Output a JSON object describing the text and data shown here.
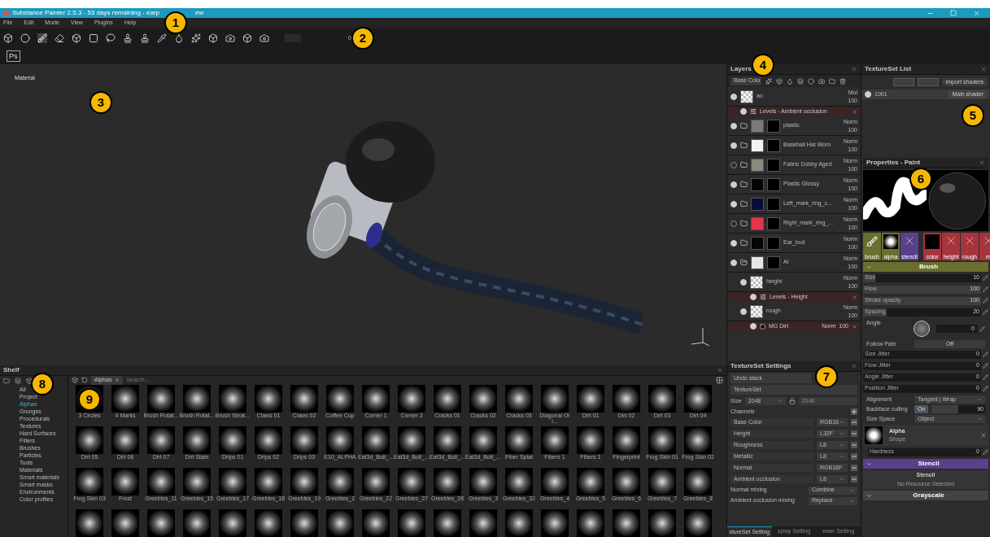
{
  "window": {
    "title": "Substance Painter 2.5.3 - 53 days remaining - earp",
    "title_tail": "ew"
  },
  "menu": [
    "File",
    "Edit",
    "Mode",
    "View",
    "Plugins",
    "Help"
  ],
  "toolbar": {
    "opacity_value": "0",
    "ps_label": "Ps"
  },
  "viewport": {
    "label": "Material"
  },
  "layers": {
    "title": "Layers",
    "channel": "Base Colo",
    "items": [
      {
        "kind": "fill",
        "name": "ao",
        "visible": true,
        "blend": "Mul",
        "opacity": "100",
        "effects": [
          {
            "kind": "levels",
            "name": "Levels - Ambient occlusion",
            "visible": true
          }
        ]
      },
      {
        "kind": "folder",
        "name": "plastic",
        "visible": true,
        "blend": "Norm",
        "opacity": "100",
        "color": "#7a7a7a"
      },
      {
        "kind": "folder",
        "name": "Baseball Hat Worn",
        "visible": true,
        "blend": "Norm",
        "opacity": "100",
        "color": "#f2f2f2"
      },
      {
        "kind": "folder",
        "name": "Fabric Dobby Aged",
        "visible": false,
        "blend": "Norm",
        "opacity": "100",
        "color": "#8c8a80"
      },
      {
        "kind": "folder",
        "name": "Plastic Glossy",
        "visible": true,
        "blend": "Norm",
        "opacity": "100",
        "color": "#050505"
      },
      {
        "kind": "folder",
        "name": "Left_mark_ring_c...",
        "visible": true,
        "blend": "Norm",
        "opacity": "100",
        "color": "#0b0b3a"
      },
      {
        "kind": "folder",
        "name": "Right_mark_ring_...",
        "visible": false,
        "blend": "Norm",
        "opacity": "100",
        "color": "#e8334a"
      },
      {
        "kind": "folder",
        "name": "Ear_bud",
        "visible": true,
        "blend": "Norm",
        "opacity": "100",
        "color": "#050505"
      },
      {
        "kind": "group",
        "name": "AI",
        "visible": true,
        "blend": "Norm",
        "opacity": "100",
        "color": "#e6e6e6",
        "children": [
          {
            "kind": "fill",
            "name": "height",
            "visible": true,
            "blend": "Norm",
            "opacity": "100",
            "effects": [
              {
                "kind": "levels",
                "name": "Levels - Height",
                "visible": true
              }
            ]
          },
          {
            "kind": "fill",
            "name": "rough",
            "visible": true,
            "blend": "Norm",
            "opacity": "100",
            "effects": [
              {
                "kind": "mask",
                "name": "MG Dirt",
                "visible": true,
                "blend": "Norm",
                "opacity": "100"
              }
            ]
          }
        ]
      }
    ]
  },
  "textureset_list": {
    "title": "TextureSet List",
    "import_button": "Import shaders",
    "rows": [
      {
        "name": "1001",
        "shader": "Main shader",
        "selected": true
      }
    ]
  },
  "properties": {
    "title": "Properties - Paint",
    "slots_left": [
      {
        "kind": "brush",
        "label": "brush"
      },
      {
        "kind": "alpha",
        "label": "alpha"
      },
      {
        "kind": "stencil",
        "label": "stencil"
      }
    ],
    "slots_right": [
      {
        "kind": "color",
        "label": "color"
      },
      {
        "kind": "empty",
        "label": "height"
      },
      {
        "kind": "empty",
        "label": "rough"
      },
      {
        "kind": "empty",
        "label": "m"
      }
    ],
    "brush_header": "Brush",
    "sliders": [
      {
        "label": "Size",
        "value": "10",
        "level": 0.1
      },
      {
        "label": "Flow",
        "value": "100",
        "level": 1
      },
      {
        "label": "Stroke opacity",
        "value": "100",
        "level": 1
      },
      {
        "label": "Spacing",
        "value": "20",
        "level": 0.2
      }
    ],
    "angle": {
      "label": "Angle",
      "value": "0"
    },
    "follow_path": {
      "label": "Follow Path",
      "value": "Off"
    },
    "jitters": [
      {
        "label": "Size Jitter",
        "value": "0"
      },
      {
        "label": "Flow Jitter",
        "value": "0"
      },
      {
        "label": "Angle Jitter",
        "value": "0"
      },
      {
        "label": "Position Jitter",
        "value": "0"
      }
    ],
    "alignment": {
      "label": "Alignment",
      "value": "Tangent | Wrap"
    },
    "backface": {
      "label": "Backface culling",
      "toggle": "On",
      "on": true,
      "value": "90",
      "level": 0.5
    },
    "size_space": {
      "label": "Size Space",
      "value": "Object"
    },
    "alpha": {
      "title": "Alpha",
      "subtitle": "Shape"
    },
    "hardness": {
      "label": "Hardness",
      "value": "0"
    },
    "stencil_header": "Stencil",
    "stencil_title": "Stencil",
    "stencil_note": "No Resource Selected",
    "grayscale_header": "Grayscale"
  },
  "textureset_settings": {
    "title": "TextureSet Settings",
    "undo": "Undo stack",
    "set_name": "TextureSet",
    "size_label": "Size",
    "size": "2048",
    "size2": "2048",
    "channels_label": "Channels",
    "channels": [
      {
        "name": "Base Color",
        "format": "RGB16"
      },
      {
        "name": "Height",
        "format": "L32F"
      },
      {
        "name": "Roughness",
        "format": "L8"
      },
      {
        "name": "Metallic",
        "format": "L8"
      },
      {
        "name": "Normal",
        "format": "RGB16F"
      },
      {
        "name": "Ambient occlusion",
        "format": "L8"
      }
    ],
    "normal_mixing": {
      "label": "Normal mixing",
      "value": "Combine"
    },
    "ao_mixing": {
      "label": "Ambient occlusion mixing",
      "value": "Replace"
    },
    "tabs": [
      {
        "label": "xtureSet Setting",
        "selected": true
      },
      {
        "label": "splay Setting",
        "selected": false
      },
      {
        "label": "ewer Setting",
        "selected": false
      }
    ]
  },
  "shelf": {
    "title": "Shelf",
    "filter": "Alphas",
    "search_placeholder": "Search...",
    "categories": [
      {
        "label": "All",
        "selected": false
      },
      {
        "label": "Project",
        "selected": false
      },
      {
        "label": "Alphas",
        "selected": true
      },
      {
        "label": "Grunges",
        "selected": false
      },
      {
        "label": "Procedurals",
        "selected": false
      },
      {
        "label": "Textures",
        "selected": false
      },
      {
        "label": "Hard Surfaces",
        "selected": false
      },
      {
        "label": "Filters",
        "selected": false
      },
      {
        "label": "Brushes",
        "selected": false
      },
      {
        "label": "Particles",
        "selected": false
      },
      {
        "label": "Tools",
        "selected": false
      },
      {
        "label": "Materials",
        "selected": false
      },
      {
        "label": "Smart materials",
        "selected": false
      },
      {
        "label": "Smart masks",
        "selected": false
      },
      {
        "label": "Environments",
        "selected": false
      },
      {
        "label": "Color profiles",
        "selected": false
      }
    ],
    "items": [
      {
        "kind": "alpha",
        "label": "3 Circles"
      },
      {
        "kind": "alpha",
        "label": "4 Marks"
      },
      {
        "kind": "alpha",
        "label": "Brush Rotat..."
      },
      {
        "kind": "alpha",
        "label": "Brush Rotat..."
      },
      {
        "kind": "alpha",
        "label": "Brush Strok..."
      },
      {
        "kind": "alpha",
        "label": "Claws 01"
      },
      {
        "kind": "alpha",
        "label": "Claws 02"
      },
      {
        "kind": "alpha",
        "label": "Coffee Cup"
      },
      {
        "kind": "alpha",
        "label": "Corner 1"
      },
      {
        "kind": "alpha",
        "label": "Corner 2"
      },
      {
        "kind": "alpha",
        "label": "Cracks 01"
      },
      {
        "kind": "alpha",
        "label": "Cracks 02"
      },
      {
        "kind": "alpha",
        "label": "Cracks 03"
      },
      {
        "kind": "alpha",
        "label": "Diagonal Ori..."
      },
      {
        "kind": "alpha",
        "label": "Dirt 01"
      },
      {
        "kind": "alpha",
        "label": "Dirt 02"
      },
      {
        "kind": "alpha",
        "label": "Dirt 03"
      },
      {
        "kind": "alpha",
        "label": "Dirt 04"
      },
      {
        "kind": "alpha",
        "label": "Dirt 05"
      },
      {
        "kind": "alpha",
        "label": "Dirt 06"
      },
      {
        "kind": "alpha",
        "label": "Dirt 07"
      },
      {
        "kind": "alpha",
        "label": "Dirt Stain"
      },
      {
        "kind": "alpha",
        "label": "Drips 01"
      },
      {
        "kind": "alpha",
        "label": "Drips 02"
      },
      {
        "kind": "alpha",
        "label": "Drips 03"
      },
      {
        "kind": "alpha",
        "label": "E10_ALPHA"
      },
      {
        "kind": "alpha",
        "label": "Eat3d_Bolt_..."
      },
      {
        "kind": "alpha",
        "label": "Eat3d_Bolt_..."
      },
      {
        "kind": "alpha",
        "label": "Eat3d_Bolt_..."
      },
      {
        "kind": "alpha",
        "label": "Eat3d_Bolt_..."
      },
      {
        "kind": "alpha",
        "label": "Fiber Splat"
      },
      {
        "kind": "alpha",
        "label": "Fibers 1"
      },
      {
        "kind": "alpha",
        "label": "Fibers 1"
      },
      {
        "kind": "alpha",
        "label": "Fingerprint"
      },
      {
        "kind": "alpha",
        "label": "Frog Skin 01"
      },
      {
        "kind": "alpha",
        "label": "Frog Skin 02"
      },
      {
        "kind": "alpha",
        "label": "Frog Skin 03"
      },
      {
        "kind": "alpha",
        "label": "Frost"
      },
      {
        "kind": "alpha",
        "label": "Greebles_11"
      },
      {
        "kind": "alpha",
        "label": "Greebles_15"
      },
      {
        "kind": "alpha",
        "label": "Greebles_17"
      },
      {
        "kind": "alpha",
        "label": "Greebles_18"
      },
      {
        "kind": "alpha",
        "label": "Greebles_19"
      },
      {
        "kind": "alpha",
        "label": "Greebles_2"
      },
      {
        "kind": "alpha",
        "label": "Greebles_22"
      },
      {
        "kind": "alpha",
        "label": "Greebles_27"
      },
      {
        "kind": "alpha",
        "label": "Greebles_28"
      },
      {
        "kind": "alpha",
        "label": "Greebles_3"
      },
      {
        "kind": "alpha",
        "label": "Greebles_32"
      },
      {
        "kind": "alpha",
        "label": "Greebles_4"
      },
      {
        "kind": "alpha",
        "label": "Greebles_5"
      },
      {
        "kind": "alpha",
        "label": "Greebles_6"
      },
      {
        "kind": "alpha",
        "label": "Greebles_7"
      },
      {
        "kind": "alpha",
        "label": "Greebles_8"
      },
      {
        "kind": "alpha"
      },
      {
        "kind": "alpha"
      },
      {
        "kind": "alpha"
      },
      {
        "kind": "alpha"
      },
      {
        "kind": "alpha"
      },
      {
        "kind": "alpha"
      },
      {
        "kind": "alpha"
      },
      {
        "kind": "alpha"
      },
      {
        "kind": "alpha"
      },
      {
        "kind": "alpha"
      },
      {
        "kind": "alpha"
      },
      {
        "kind": "alpha"
      },
      {
        "kind": "alpha"
      },
      {
        "kind": "alpha"
      },
      {
        "kind": "alpha"
      },
      {
        "kind": "alpha"
      },
      {
        "kind": "alpha"
      },
      {
        "kind": "alpha"
      }
    ]
  },
  "callouts": [
    "1",
    "2",
    "3",
    "4",
    "5",
    "6",
    "7",
    "8",
    "9"
  ]
}
